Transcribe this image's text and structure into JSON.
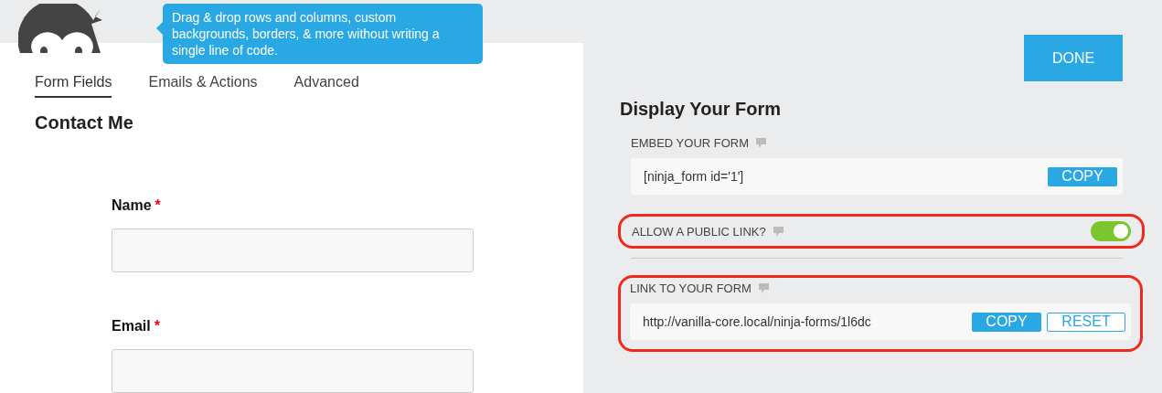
{
  "tooltip": "Drag & drop rows and columns, custom backgrounds, borders, & more without writing a single line of code.",
  "tabs": [
    {
      "label": "Form Fields",
      "selected": true
    },
    {
      "label": "Emails & Actions",
      "selected": false
    },
    {
      "label": "Advanced",
      "selected": false
    }
  ],
  "form_title": "Contact Me",
  "fields": [
    {
      "label": "Name",
      "required": true,
      "marker": "*"
    },
    {
      "label": "Email",
      "required": true,
      "marker": "*"
    }
  ],
  "done_button": "DONE",
  "display": {
    "title": "Display Your Form",
    "embed": {
      "label": "EMBED YOUR FORM",
      "value": "[ninja_form id='1']",
      "copy": "COPY"
    },
    "public_link": {
      "label": "ALLOW A PUBLIC LINK?",
      "on": true,
      "highlighted": true
    },
    "link": {
      "label": "LINK TO YOUR FORM",
      "value": "http://vanilla-core.local/ninja-forms/1l6dc",
      "copy": "COPY",
      "reset": "RESET",
      "highlighted": true
    }
  }
}
